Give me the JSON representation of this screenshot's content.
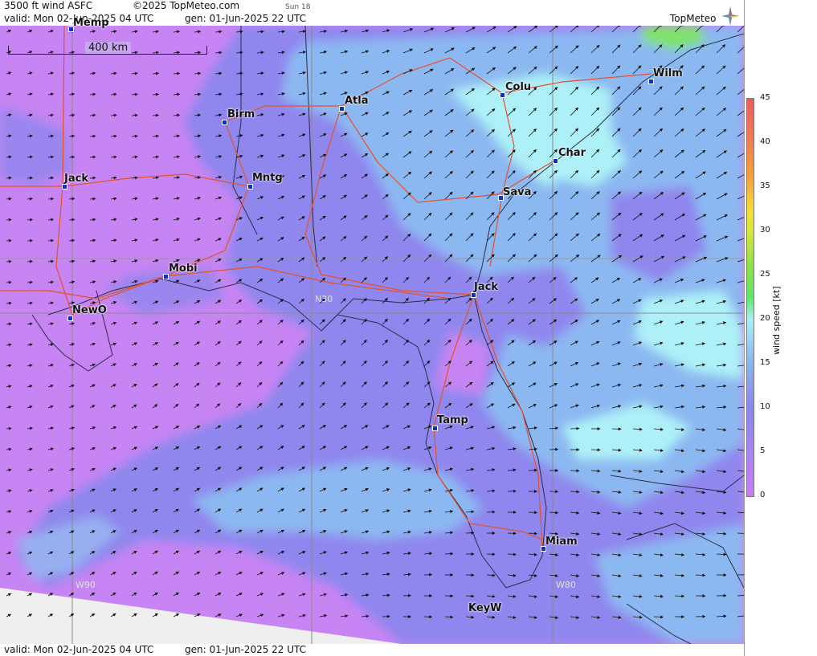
{
  "header": {
    "product": "3500 ft wind ASFC",
    "copyright": "©2025 TopMeteo.com",
    "sun": "Sun 18",
    "valid": "valid:  Mon  02-Jun-2025  04 UTC",
    "gen": "gen:  01-Jun-2025 22 UTC",
    "logo": "TopMeteo"
  },
  "footer": {
    "valid": "valid:  Mon  02-Jun-2025  04 UTC",
    "gen": "gen:  01-Jun-2025 22 UTC"
  },
  "scale_bar": {
    "label": "400 km"
  },
  "legend": {
    "unit_label": "wind speed [kt]",
    "ticks": [
      "45",
      "40",
      "35",
      "30",
      "25",
      "20",
      "15",
      "10",
      "5",
      "0"
    ],
    "colors": [
      "#ee5b5b",
      "#f17a52",
      "#f6a23b",
      "#f6de38",
      "#8ae24a",
      "#5fe86a",
      "#a9eff7",
      "#8ab4ef",
      "#8a86ec",
      "#c77cf5"
    ]
  },
  "cities": [
    {
      "name": "Memp"
    },
    {
      "name": "Atla"
    },
    {
      "name": "Colu"
    },
    {
      "name": "Wilm"
    },
    {
      "name": "Birm"
    },
    {
      "name": "Char"
    },
    {
      "name": "Jack"
    },
    {
      "name": "Mntg"
    },
    {
      "name": "Sava"
    },
    {
      "name": "Mobi"
    },
    {
      "name": "Jack"
    },
    {
      "name": "NewO"
    },
    {
      "name": "Tamp"
    },
    {
      "name": "Miam"
    },
    {
      "name": "KeyW"
    }
  ],
  "grid_labels": {
    "lat": "N30",
    "lon1": "W90",
    "lon2": "W80"
  }
}
